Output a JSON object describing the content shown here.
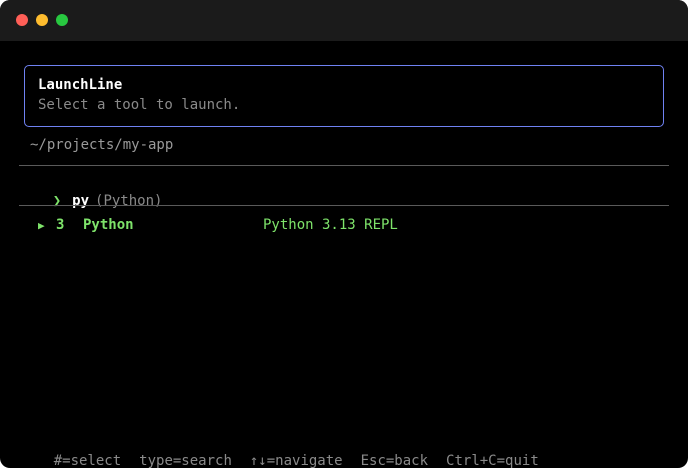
{
  "window": {
    "controls": [
      "close",
      "minimize",
      "zoom"
    ]
  },
  "header": {
    "title": "LaunchLine",
    "subtitle": "Select a tool to launch."
  },
  "cwd": "~/projects/my-app",
  "prompt": {
    "glyph": "❯",
    "query": "py",
    "hint": "(Python)"
  },
  "results": [
    {
      "marker": "▶",
      "key": "3",
      "name": "Python",
      "description": "Python 3.13 REPL"
    }
  ],
  "footer": {
    "hints": [
      "#=select",
      "type=search",
      "↑↓=navigate",
      "Esc=back",
      "Ctrl+C=quit"
    ]
  },
  "colors": {
    "accent_border": "#6f82f3",
    "highlight": "#7ee36a",
    "muted": "#8a8a8a",
    "background": "#000000",
    "titlebar": "#1b1b1b"
  }
}
